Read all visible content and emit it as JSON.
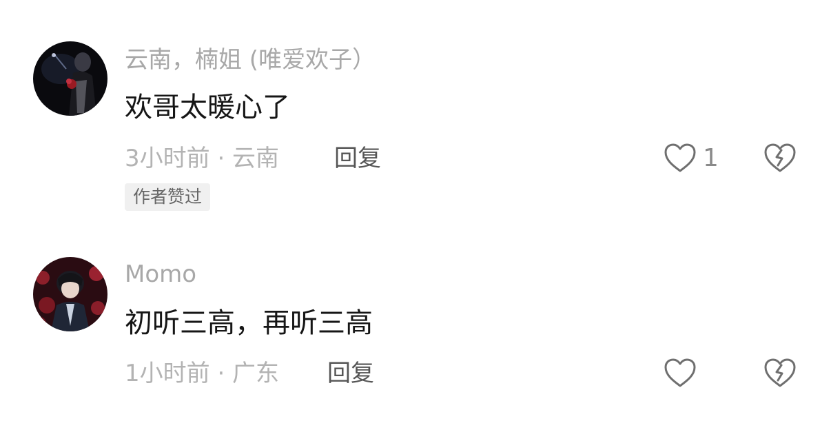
{
  "comments": [
    {
      "username": "云南，楠姐 (唯爱欢子）",
      "content": "欢哥太暖心了",
      "time_location": "3小时前 · 云南",
      "reply_label": "回复",
      "badge": "作者赞过",
      "like_count": "1"
    },
    {
      "username": "Momo",
      "content": "初听三高，再听三高",
      "time_location": "1小时前 · 广东",
      "reply_label": "回复"
    }
  ],
  "icons": {
    "like": "heart-outline-icon",
    "dislike": "broken-heart-icon"
  },
  "colors": {
    "username": "#a8a8a8",
    "content": "#161616",
    "meta": "#b3b3b3",
    "icon_stroke": "#6f6f6f",
    "badge_bg": "#f0f0f0"
  }
}
